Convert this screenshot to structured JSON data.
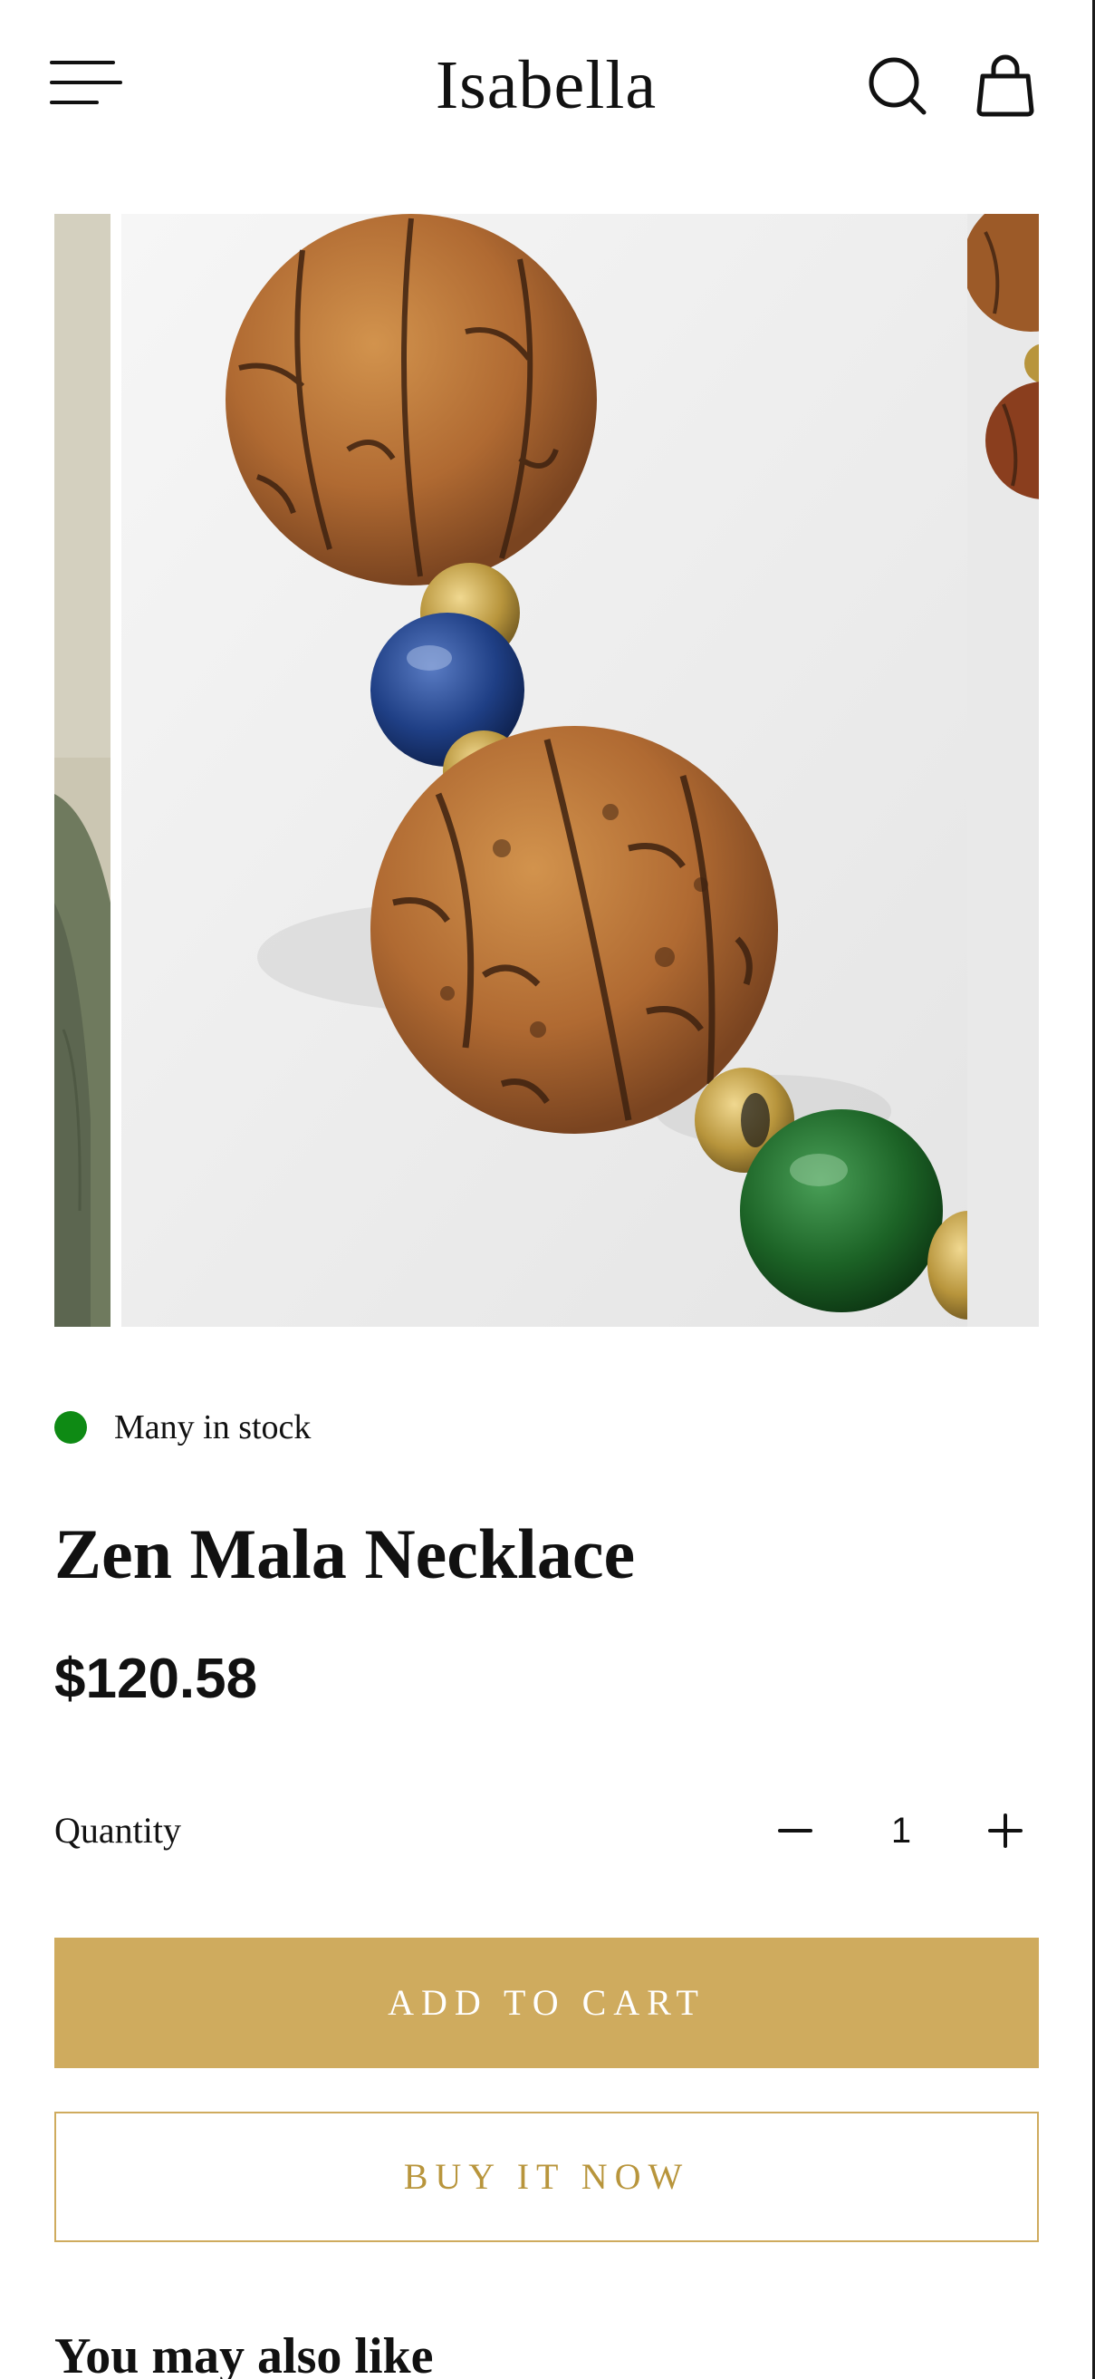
{
  "header": {
    "logo": "Isabella",
    "icons": {
      "menu": "hamburger-menu-icon",
      "search": "search-icon",
      "cart": "shopping-bag-icon"
    }
  },
  "gallery": {
    "slides": [
      "prev-slide",
      "main-slide",
      "next-slide"
    ],
    "main_subject": "rudraksha-and-gemstone-beads"
  },
  "product": {
    "stock_text": "Many in stock",
    "stock_color": "#0e8a14",
    "title": "Zen Mala Necklace",
    "price": "$120.58"
  },
  "quantity": {
    "label": "Quantity",
    "value": "1"
  },
  "actions": {
    "add_to_cart": "ADD TO CART",
    "buy_now": "BUY IT NOW"
  },
  "recommendations": {
    "heading": "You may also like"
  },
  "colors": {
    "accent": "#cfab5e",
    "accent_text": "#b8953c",
    "text": "#111111"
  }
}
